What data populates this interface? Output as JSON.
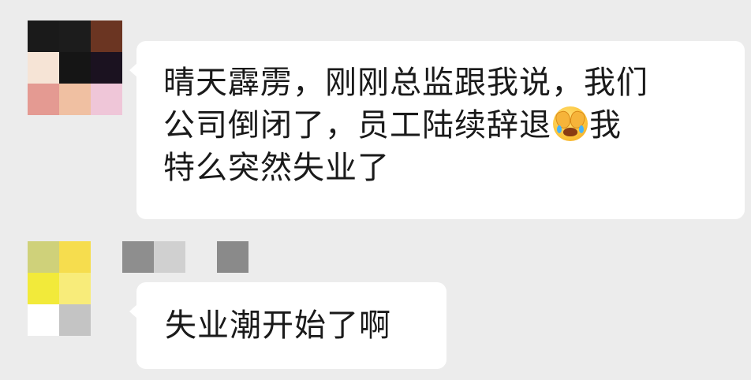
{
  "colors": {
    "background": "#ececec",
    "bubble": "#ffffff",
    "text": "#1a1a1a"
  },
  "messages": [
    {
      "sender_avatar_pixels": [
        "#1a1a1a",
        "#1c1c1c",
        "#6b3522",
        "#f6e4d6",
        "#151515",
        "#1b1220",
        "#e49a92",
        "#f0c0a2",
        "#efc6d8"
      ],
      "lines": [
        {
          "text": "晴天霹雳，刚刚总监跟我说，我们"
        },
        {
          "text_before": "公司倒闭了，员工陆续辞退",
          "emoji": "face-with-hands-crying-icon",
          "text_after": "我"
        },
        {
          "text": "特么突然失业了"
        }
      ]
    },
    {
      "sender_avatar_pixels": [
        "#cfd17a",
        "#f6dd4e",
        "#ececec",
        "#f2ea3a",
        "#f8ec7a",
        "#ececec",
        "#ffffff",
        "#c4c4c4",
        "#ececec"
      ],
      "sender_name_pixels": [
        "#8e8e8e",
        "#d0d0d0",
        "#ececec",
        "#8a8a8a"
      ],
      "lines": [
        {
          "text": "失业潮开始了啊"
        }
      ]
    }
  ]
}
